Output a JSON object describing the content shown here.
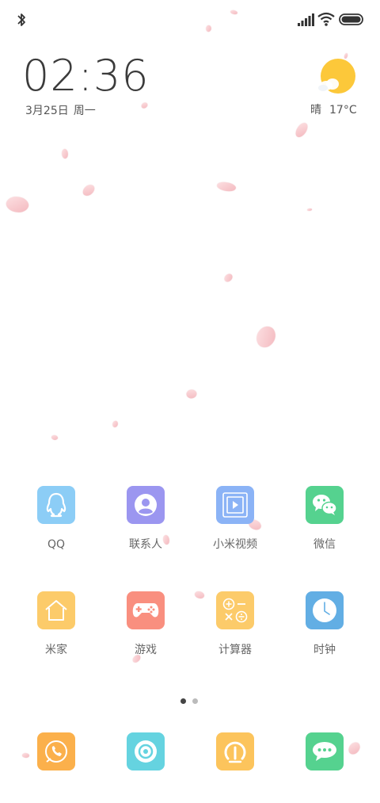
{
  "clock": {
    "time": "02:36",
    "date": "3月25日",
    "weekday": "周一"
  },
  "weather": {
    "condition": "晴",
    "temperature": "17°C",
    "icon": "sunny-icon"
  },
  "apps_row1": [
    {
      "label": "QQ",
      "icon": "qq-icon",
      "color": "#8ccdf6"
    },
    {
      "label": "联系人",
      "icon": "contacts-icon",
      "color": "#9b96f0"
    },
    {
      "label": "小米视频",
      "icon": "video-icon",
      "color": "#8bb3f6"
    },
    {
      "label": "微信",
      "icon": "wechat-icon",
      "color": "#55d28f"
    }
  ],
  "apps_row2": [
    {
      "label": "米家",
      "icon": "home-icon",
      "color": "#fccb6a"
    },
    {
      "label": "游戏",
      "icon": "gamepad-icon",
      "color": "#f98f7f"
    },
    {
      "label": "计算器",
      "icon": "calculator-icon",
      "color": "#fccb6a"
    },
    {
      "label": "时钟",
      "icon": "clock-icon",
      "color": "#62aee4"
    }
  ],
  "dock": [
    {
      "icon": "phone-icon",
      "color": "#fbb04b"
    },
    {
      "icon": "camera-icon",
      "color": "#65d3e0"
    },
    {
      "icon": "browser-icon",
      "color": "#fcc45c"
    },
    {
      "icon": "messages-icon",
      "color": "#55d28f"
    }
  ],
  "page_indicator": {
    "pages": 2,
    "current": 1
  }
}
